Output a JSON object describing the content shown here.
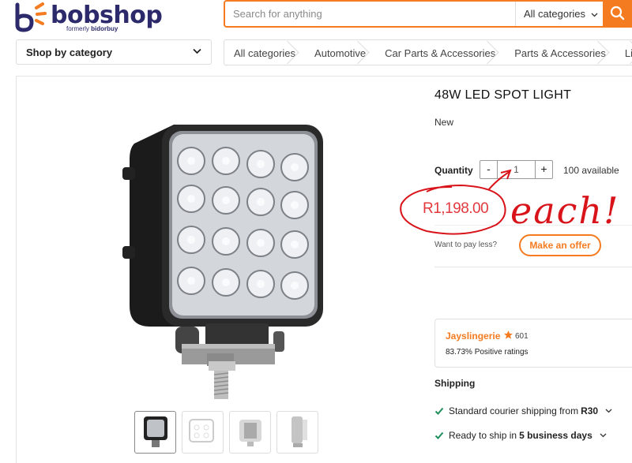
{
  "header": {
    "logo_text": "bobshop",
    "logo_sub_prefix": "formerly ",
    "logo_sub_brand": "bidorbuy",
    "search_placeholder": "Search for anything",
    "search_category": "All categories"
  },
  "nav": {
    "shop_by_category": "Shop by category",
    "breadcrumb": [
      "All categories",
      "Automotive",
      "Car Parts & Accessories",
      "Parts & Accessories",
      "Lig"
    ]
  },
  "product": {
    "title": "48W LED SPOT LIGHT",
    "condition": "New",
    "quantity_label": "Quantity",
    "quantity_minus": "-",
    "quantity_value": "1",
    "quantity_plus": "+",
    "available": "100 available",
    "price": "R1,198.00",
    "pay_less": "Want to pay less?",
    "offer_button": "Make an offer"
  },
  "seller": {
    "name": "Jayslingerie",
    "count": "601",
    "rating": "83.73% Positive ratings"
  },
  "shipping": {
    "heading": "Shipping",
    "courier_prefix": "Standard courier shipping from",
    "courier_price": "R30",
    "ready_prefix": "Ready to ship in",
    "ready_days": "5 business days"
  },
  "annotation": {
    "text": "each!"
  },
  "colors": {
    "brand_orange": "#f47b20",
    "brand_navy": "#2c2a6b",
    "price_red": "#e2393e",
    "annotation_red": "#d8141a",
    "check_green": "#1e8e5a"
  }
}
